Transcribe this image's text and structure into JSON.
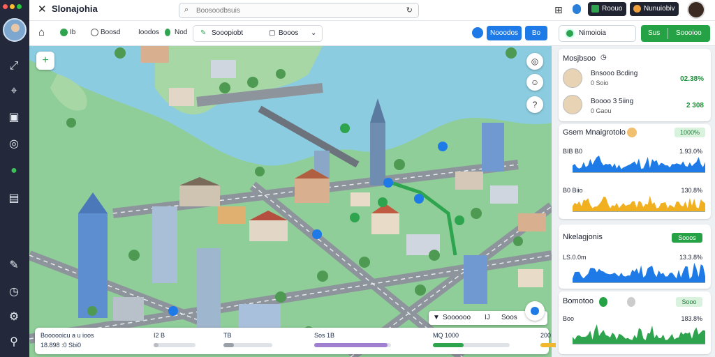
{
  "window": {
    "title": "Slonajohia",
    "traffic_lights": [
      "#ff5f57",
      "#febc2e",
      "#28c840"
    ]
  },
  "search": {
    "placeholder": "Boosoodbsuis"
  },
  "top_buttons": [
    {
      "label": "Roouo",
      "icon": "green-square-icon",
      "color": "#2ea44f"
    },
    {
      "label": "Nunuiobiv",
      "icon": "user-badge-icon",
      "color": "#f0a03a"
    }
  ],
  "toolbar": {
    "items": [
      "Ib",
      "Boosd",
      "Ioodos",
      "Nod"
    ],
    "group": [
      "Sooopiobt",
      "Booos"
    ],
    "blue_buttons": [
      "Nooodos",
      "Bo"
    ],
    "nav_button": "Nimoioia",
    "green_button": {
      "left": "Sus",
      "right": "Soooioo"
    }
  },
  "route_card": {
    "left": "Soooooo",
    "mid": "IJ",
    "right": "Soos"
  },
  "bottom_panel": {
    "title": "Boooooicu a u ioos",
    "stat": "18.898  :0 Sbi0",
    "bars": [
      {
        "label": "I2",
        "value": "B",
        "level": 0.12,
        "color": "#b9bcc3"
      },
      {
        "label": "TB",
        "value": "",
        "level": 0.22,
        "color": "#9aa0a8"
      },
      {
        "label": "Sos",
        "value": "1B",
        "level": 0.95,
        "color": "#a07fd0"
      },
      {
        "label": "MQ",
        "value": "1000",
        "level": 0.4,
        "color": "#2ea44f"
      },
      {
        "label": "",
        "value": "200",
        "level": 0.55,
        "color": "#f0b72f"
      }
    ]
  },
  "panel": {
    "team_card": {
      "title": "Mosjbsoo",
      "people": [
        {
          "name": "Bnsooo Bcding",
          "sub": "0 Soio",
          "value": "02.38%"
        },
        {
          "name": "Boooo 3 5iing",
          "sub": "0 Gaou",
          "value": "2 308"
        }
      ]
    },
    "metrics_card": {
      "title": "Gsem Mnaigrotolo",
      "badge": "1000%",
      "rows": [
        {
          "label": "BIB B0",
          "value": "1.93.0%",
          "color": "#1d7ae6"
        },
        {
          "label": "B0 Biio",
          "value": "130.8%",
          "color": "#f0b020"
        }
      ]
    },
    "stats_card": {
      "title": "Nkelagjonis",
      "button": "Sooos",
      "rows": [
        {
          "label": "LS.0.0m",
          "value": "13.3.8%",
          "color": "#1d7ae6"
        }
      ]
    },
    "last_card": {
      "title": "Bomotoo",
      "badge": "Sooo",
      "rows": [
        {
          "label": "Boo",
          "value": "183.8%",
          "color": "#2ea44f"
        }
      ]
    }
  }
}
